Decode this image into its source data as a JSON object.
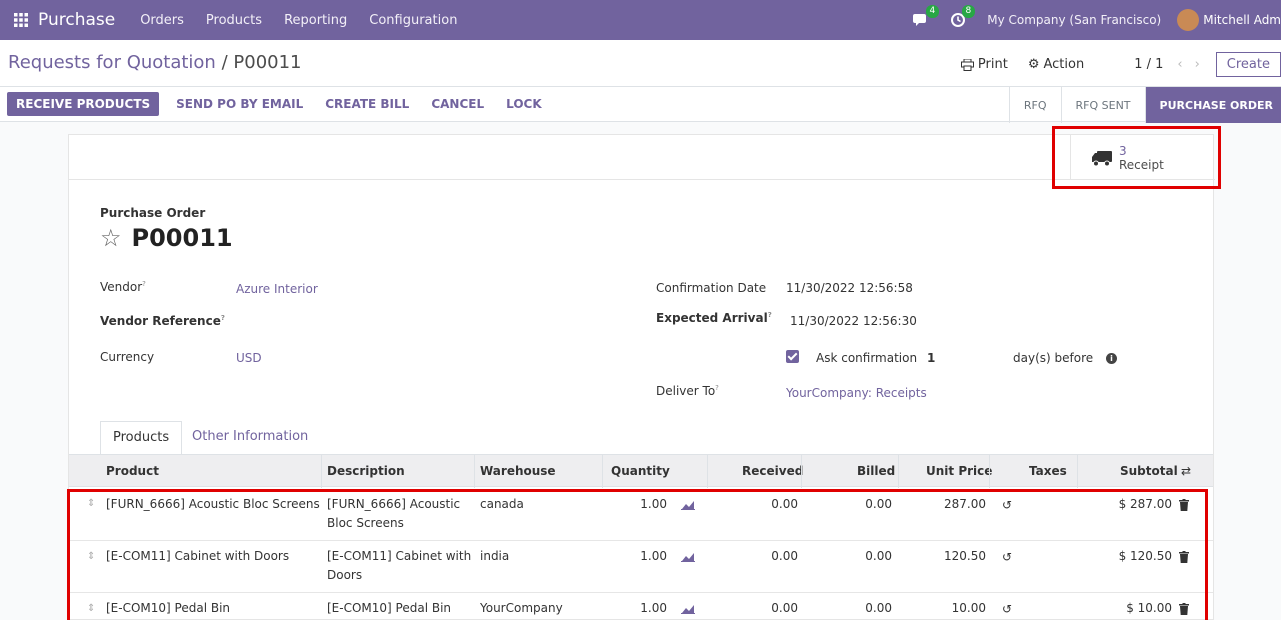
{
  "navbar": {
    "brand": "Purchase",
    "menu": [
      "Orders",
      "Products",
      "Reporting",
      "Configuration"
    ],
    "messages_count": "4",
    "activities_count": "8",
    "company": "My Company (San Francisco)",
    "user": "Mitchell Adm"
  },
  "control_panel": {
    "breadcrumb_parent": "Requests for Quotation",
    "breadcrumb_sep": "/",
    "breadcrumb_current": "P00011",
    "print_label": "Print",
    "action_label": "Action",
    "pager": "1 / 1",
    "create_label": "Create"
  },
  "statusbar": {
    "buttons": [
      "RECEIVE PRODUCTS",
      "SEND PO BY EMAIL",
      "CREATE BILL",
      "CANCEL",
      "LOCK"
    ],
    "stages": [
      "RFQ",
      "RFQ SENT",
      "PURCHASE ORDER"
    ],
    "active_stage": "PURCHASE ORDER"
  },
  "smart_button": {
    "value": "3",
    "label": "Receipt",
    "icon": "truck-icon"
  },
  "form": {
    "title_label": "Purchase Order",
    "po_number": "P00011",
    "vendor_label": "Vendor",
    "vendor_value": "Azure Interior",
    "vendor_ref_label": "Vendor Reference",
    "currency_label": "Currency",
    "currency_value": "USD",
    "confirmation_date_label": "Confirmation Date",
    "confirmation_date_value": "11/30/2022 12:56:58",
    "expected_arrival_label": "Expected Arrival",
    "expected_arrival_value": "11/30/2022 12:56:30",
    "ask_confirmation_label": "Ask confirmation",
    "ask_confirmation_checked": true,
    "ask_confirmation_days": "1",
    "days_before_label": "day(s) before",
    "deliver_to_label": "Deliver To",
    "deliver_to_value": "YourCompany: Receipts",
    "help_marker": "?"
  },
  "tabs": [
    "Products",
    "Other Information"
  ],
  "table": {
    "headers": {
      "product": "Product",
      "description": "Description",
      "warehouse": "Warehouse",
      "quantity": "Quantity",
      "received": "Received",
      "billed": "Billed",
      "unit_price": "Unit Price",
      "taxes": "Taxes",
      "subtotal": "Subtotal"
    },
    "rows": [
      {
        "product": "[FURN_6666] Acoustic Bloc Screens",
        "description": "[FURN_6666] Acoustic Bloc Screens",
        "warehouse": "canada",
        "quantity": "1.00",
        "received": "0.00",
        "billed": "0.00",
        "unit_price": "287.00",
        "subtotal": "$ 287.00"
      },
      {
        "product": "[E-COM11] Cabinet with Doors",
        "description": "[E-COM11] Cabinet with Doors",
        "warehouse": "india",
        "quantity": "1.00",
        "received": "0.00",
        "billed": "0.00",
        "unit_price": "120.50",
        "subtotal": "$ 120.50"
      },
      {
        "product": "[E-COM10] Pedal Bin",
        "description": "[E-COM10] Pedal Bin",
        "warehouse": "YourCompany",
        "quantity": "1.00",
        "received": "0.00",
        "billed": "0.00",
        "unit_price": "10.00",
        "subtotal": "$ 10.00"
      }
    ]
  },
  "colors": {
    "primary": "#71639e",
    "highlight": "#e00000"
  }
}
